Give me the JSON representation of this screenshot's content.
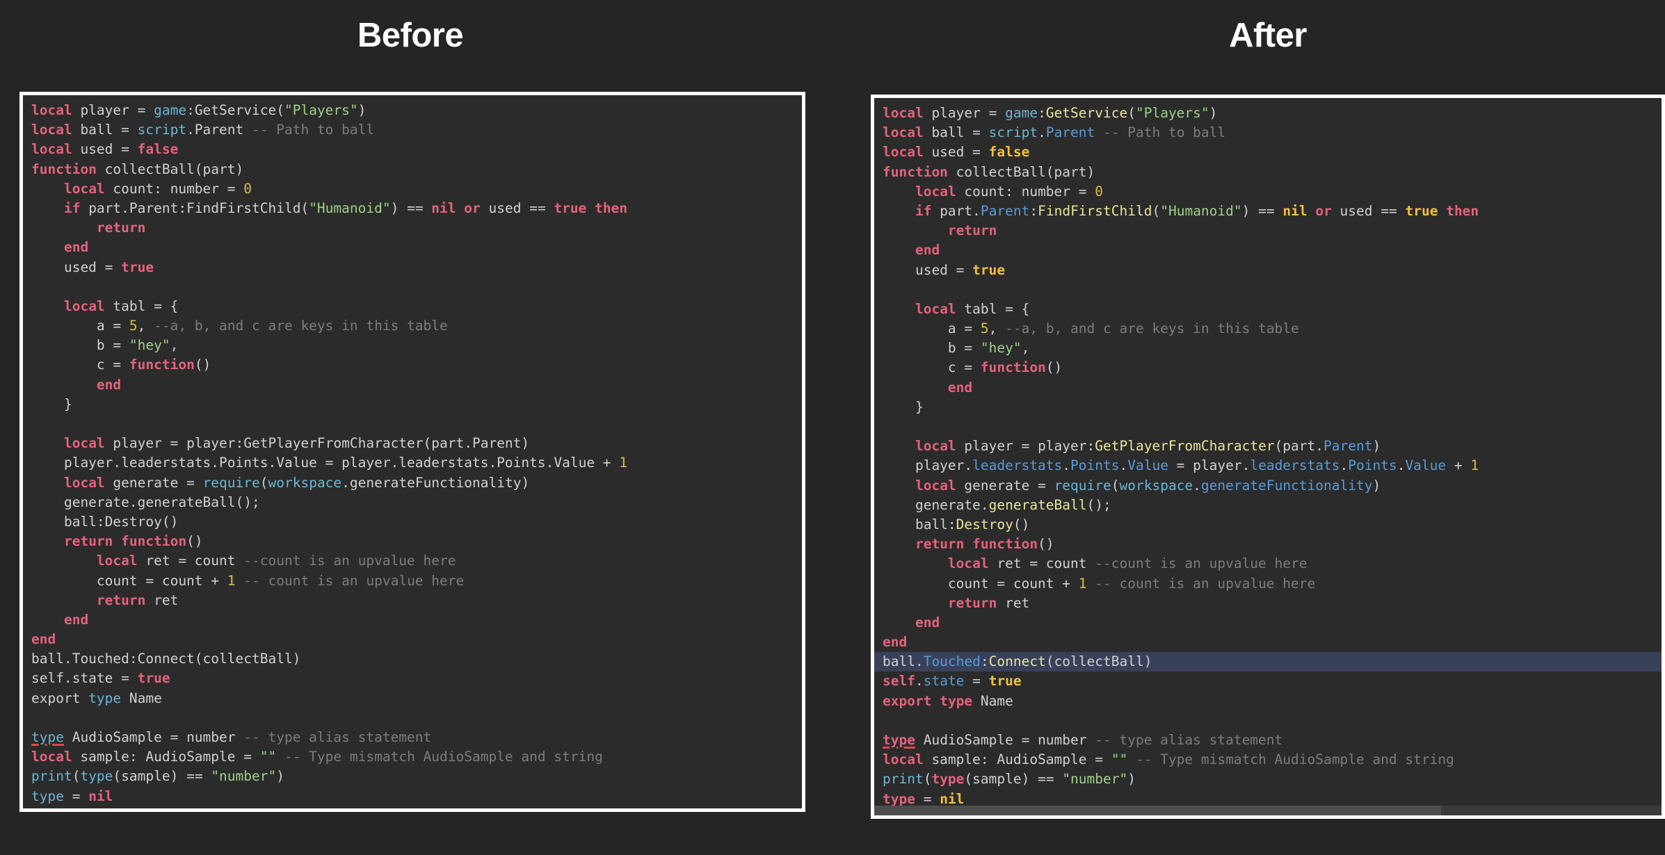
{
  "headings": {
    "before": "Before",
    "after": "After"
  },
  "theme": {
    "page_background": "#252525",
    "editor_background": "#2b2b2b",
    "panel_border": "#ffffff",
    "heading_color": "#ffffff",
    "selected_line_background": "#39415a",
    "error_underline": "#e0484c",
    "before": {
      "keyword": "#e4637c",
      "plain": "#cfd2d1",
      "string": "#9fd28a",
      "number": "#d9bf48",
      "comment": "#7d7d7d",
      "global": "#6cb5d6"
    },
    "after": {
      "keyword": "#e4637c",
      "plain": "#cfd2d1",
      "string": "#9fd28a",
      "number": "#d9bf48",
      "comment": "#7d7d7d",
      "boolean": "#f2c040",
      "property": "#5b9bd8",
      "method": "#e7e79b",
      "global": "#6cb5d6"
    }
  },
  "language": "Luau",
  "before_panel": {
    "selected_line_index": null,
    "has_horizontal_scrollbar": false,
    "lines": [
      [
        [
          "b-kw",
          "local"
        ],
        [
          "b-plain",
          " player = "
        ],
        [
          "b-blue",
          "game"
        ],
        [
          "b-plain",
          ":GetService("
        ],
        [
          "b-str",
          "\"Players\""
        ],
        [
          "b-plain",
          ")"
        ]
      ],
      [
        [
          "b-kw",
          "local"
        ],
        [
          "b-plain",
          " ball = "
        ],
        [
          "b-blue",
          "script"
        ],
        [
          "b-plain",
          ".Parent "
        ],
        [
          "b-cmt",
          "-- Path to ball"
        ]
      ],
      [
        [
          "b-kw",
          "local"
        ],
        [
          "b-plain",
          " used = "
        ],
        [
          "b-kw",
          "false"
        ]
      ],
      [
        [
          "b-kw",
          "function"
        ],
        [
          "b-plain",
          " collectBall(part)"
        ]
      ],
      [
        [
          "b-plain",
          "    "
        ],
        [
          "b-kw",
          "local"
        ],
        [
          "b-plain",
          " count: number = "
        ],
        [
          "b-num",
          "0"
        ]
      ],
      [
        [
          "b-plain",
          "    "
        ],
        [
          "b-kw",
          "if"
        ],
        [
          "b-plain",
          " part.Parent:FindFirstChild("
        ],
        [
          "b-str",
          "\"Humanoid\""
        ],
        [
          "b-plain",
          ") == "
        ],
        [
          "b-kw",
          "nil"
        ],
        [
          "b-plain",
          " "
        ],
        [
          "b-kw",
          "or"
        ],
        [
          "b-plain",
          " used == "
        ],
        [
          "b-kw",
          "true"
        ],
        [
          "b-plain",
          " "
        ],
        [
          "b-kw",
          "then"
        ]
      ],
      [
        [
          "b-plain",
          "        "
        ],
        [
          "b-kw",
          "return"
        ]
      ],
      [
        [
          "b-plain",
          "    "
        ],
        [
          "b-kw",
          "end"
        ]
      ],
      [
        [
          "b-plain",
          "    used = "
        ],
        [
          "b-kw",
          "true"
        ]
      ],
      [
        [
          "b-plain",
          ""
        ]
      ],
      [
        [
          "b-plain",
          "    "
        ],
        [
          "b-kw",
          "local"
        ],
        [
          "b-plain",
          " tabl = {"
        ]
      ],
      [
        [
          "b-plain",
          "        a = "
        ],
        [
          "b-num",
          "5"
        ],
        [
          "b-plain",
          ", "
        ],
        [
          "b-cmt",
          "--a, b, and c are keys in this table"
        ]
      ],
      [
        [
          "b-plain",
          "        b = "
        ],
        [
          "b-str",
          "\"hey\""
        ],
        [
          "b-plain",
          ","
        ]
      ],
      [
        [
          "b-plain",
          "        c = "
        ],
        [
          "b-kw",
          "function"
        ],
        [
          "b-plain",
          "()"
        ]
      ],
      [
        [
          "b-plain",
          "        "
        ],
        [
          "b-kw",
          "end"
        ]
      ],
      [
        [
          "b-plain",
          "    }"
        ]
      ],
      [
        [
          "b-plain",
          ""
        ]
      ],
      [
        [
          "b-plain",
          "    "
        ],
        [
          "b-kw",
          "local"
        ],
        [
          "b-plain",
          " player = player:GetPlayerFromCharacter(part.Parent)"
        ]
      ],
      [
        [
          "b-plain",
          "    player.leaderstats.Points.Value = player.leaderstats.Points.Value + "
        ],
        [
          "b-num",
          "1"
        ]
      ],
      [
        [
          "b-plain",
          "    "
        ],
        [
          "b-kw",
          "local"
        ],
        [
          "b-plain",
          " generate = "
        ],
        [
          "b-blue",
          "require"
        ],
        [
          "b-plain",
          "("
        ],
        [
          "b-blue",
          "workspace"
        ],
        [
          "b-plain",
          ".generateFunctionality)"
        ]
      ],
      [
        [
          "b-plain",
          "    generate.generateBall();"
        ]
      ],
      [
        [
          "b-plain",
          "    ball:Destroy()"
        ]
      ],
      [
        [
          "b-plain",
          "    "
        ],
        [
          "b-kw",
          "return function"
        ],
        [
          "b-plain",
          "()"
        ]
      ],
      [
        [
          "b-plain",
          "        "
        ],
        [
          "b-kw",
          "local"
        ],
        [
          "b-plain",
          " ret = count "
        ],
        [
          "b-cmt",
          "--count is an upvalue here"
        ]
      ],
      [
        [
          "b-plain",
          "        count = count + "
        ],
        [
          "b-num",
          "1"
        ],
        [
          "b-plain",
          " "
        ],
        [
          "b-cmt",
          "-- count is an upvalue here"
        ]
      ],
      [
        [
          "b-plain",
          "        "
        ],
        [
          "b-kw",
          "return"
        ],
        [
          "b-plain",
          " ret"
        ]
      ],
      [
        [
          "b-plain",
          "    "
        ],
        [
          "b-kw",
          "end"
        ]
      ],
      [
        [
          "b-kw",
          "end"
        ]
      ],
      [
        [
          "b-plain",
          "ball.Touched:Connect(collectBall)"
        ]
      ],
      [
        [
          "b-plain",
          "self.state = "
        ],
        [
          "b-kw",
          "true"
        ]
      ],
      [
        [
          "b-plain",
          "export "
        ],
        [
          "b-blue",
          "type"
        ],
        [
          "b-plain",
          " Name"
        ]
      ],
      [
        [
          "b-plain",
          ""
        ]
      ],
      [
        [
          "b-err",
          "type"
        ],
        [
          "b-plain",
          " AudioSample = number "
        ],
        [
          "b-cmt",
          "-- type alias statement"
        ]
      ],
      [
        [
          "b-kw",
          "local"
        ],
        [
          "b-plain",
          " sample: AudioSample = "
        ],
        [
          "b-str",
          "\"\""
        ],
        [
          "b-plain",
          " "
        ],
        [
          "b-cmt",
          "-- Type mismatch AudioSample and string"
        ]
      ],
      [
        [
          "b-blue",
          "print"
        ],
        [
          "b-plain",
          "("
        ],
        [
          "b-blue",
          "type"
        ],
        [
          "b-plain",
          "(sample) == "
        ],
        [
          "b-str",
          "\"number\""
        ],
        [
          "b-plain",
          ")"
        ]
      ],
      [
        [
          "b-blue",
          "type"
        ],
        [
          "b-plain",
          " = "
        ],
        [
          "b-kw",
          "nil"
        ]
      ]
    ]
  },
  "after_panel": {
    "selected_line_index": 28,
    "selected_line_text": "ball.Touched:Connect(collectBall)",
    "has_horizontal_scrollbar": true,
    "lines": [
      [
        [
          "a-kw",
          "local"
        ],
        [
          "a-plain",
          " player = "
        ],
        [
          "a-global",
          "game"
        ],
        [
          "a-plain",
          ":"
        ],
        [
          "a-method",
          "GetService"
        ],
        [
          "a-plain",
          "("
        ],
        [
          "a-str",
          "\"Players\""
        ],
        [
          "a-plain",
          ")"
        ]
      ],
      [
        [
          "a-kw",
          "local"
        ],
        [
          "a-plain",
          " ball = "
        ],
        [
          "a-global",
          "script"
        ],
        [
          "a-plain",
          "."
        ],
        [
          "a-prop",
          "Parent"
        ],
        [
          "a-plain",
          " "
        ],
        [
          "a-cmt",
          "-- Path to ball"
        ]
      ],
      [
        [
          "a-kw",
          "local"
        ],
        [
          "a-plain",
          " used = "
        ],
        [
          "a-bool",
          "false"
        ]
      ],
      [
        [
          "a-kw",
          "function"
        ],
        [
          "a-plain",
          " collectBall(part)"
        ]
      ],
      [
        [
          "a-plain",
          "    "
        ],
        [
          "a-kw",
          "local"
        ],
        [
          "a-plain",
          " count: number = "
        ],
        [
          "a-num",
          "0"
        ]
      ],
      [
        [
          "a-plain",
          "    "
        ],
        [
          "a-kw",
          "if"
        ],
        [
          "a-plain",
          " part."
        ],
        [
          "a-prop",
          "Parent"
        ],
        [
          "a-plain",
          ":"
        ],
        [
          "a-method",
          "FindFirstChild"
        ],
        [
          "a-plain",
          "("
        ],
        [
          "a-str",
          "\"Humanoid\""
        ],
        [
          "a-plain",
          ") == "
        ],
        [
          "a-bool",
          "nil"
        ],
        [
          "a-plain",
          " "
        ],
        [
          "a-kw",
          "or"
        ],
        [
          "a-plain",
          " used == "
        ],
        [
          "a-bool",
          "true"
        ],
        [
          "a-plain",
          " "
        ],
        [
          "a-kw",
          "then"
        ]
      ],
      [
        [
          "a-plain",
          "        "
        ],
        [
          "a-kw",
          "return"
        ]
      ],
      [
        [
          "a-plain",
          "    "
        ],
        [
          "a-kw",
          "end"
        ]
      ],
      [
        [
          "a-plain",
          "    used = "
        ],
        [
          "a-bool",
          "true"
        ]
      ],
      [
        [
          "a-plain",
          ""
        ]
      ],
      [
        [
          "a-plain",
          "    "
        ],
        [
          "a-kw",
          "local"
        ],
        [
          "a-plain",
          " tabl = {"
        ]
      ],
      [
        [
          "a-plain",
          "        a = "
        ],
        [
          "a-num",
          "5"
        ],
        [
          "a-plain",
          ", "
        ],
        [
          "a-cmt",
          "--a, b, and c are keys in this table"
        ]
      ],
      [
        [
          "a-plain",
          "        b = "
        ],
        [
          "a-str",
          "\"hey\""
        ],
        [
          "a-plain",
          ","
        ]
      ],
      [
        [
          "a-plain",
          "        c = "
        ],
        [
          "a-kw",
          "function"
        ],
        [
          "a-plain",
          "()"
        ]
      ],
      [
        [
          "a-plain",
          "        "
        ],
        [
          "a-kw",
          "end"
        ]
      ],
      [
        [
          "a-plain",
          "    }"
        ]
      ],
      [
        [
          "a-plain",
          ""
        ]
      ],
      [
        [
          "a-plain",
          "    "
        ],
        [
          "a-kw",
          "local"
        ],
        [
          "a-plain",
          " player = player:"
        ],
        [
          "a-method",
          "GetPlayerFromCharacter"
        ],
        [
          "a-plain",
          "(part."
        ],
        [
          "a-prop",
          "Parent"
        ],
        [
          "a-plain",
          ")"
        ]
      ],
      [
        [
          "a-plain",
          "    player."
        ],
        [
          "a-prop",
          "leaderstats"
        ],
        [
          "a-plain",
          "."
        ],
        [
          "a-prop",
          "Points"
        ],
        [
          "a-plain",
          "."
        ],
        [
          "a-prop",
          "Value"
        ],
        [
          "a-plain",
          " = player."
        ],
        [
          "a-prop",
          "leaderstats"
        ],
        [
          "a-plain",
          "."
        ],
        [
          "a-prop",
          "Points"
        ],
        [
          "a-plain",
          "."
        ],
        [
          "a-prop",
          "Value"
        ],
        [
          "a-plain",
          " + "
        ],
        [
          "a-num",
          "1"
        ]
      ],
      [
        [
          "a-plain",
          "    "
        ],
        [
          "a-kw",
          "local"
        ],
        [
          "a-plain",
          " generate = "
        ],
        [
          "a-global",
          "require"
        ],
        [
          "a-plain",
          "("
        ],
        [
          "a-global",
          "workspace"
        ],
        [
          "a-plain",
          "."
        ],
        [
          "a-prop",
          "generateFunctionality"
        ],
        [
          "a-plain",
          ")"
        ]
      ],
      [
        [
          "a-plain",
          "    generate."
        ],
        [
          "a-method",
          "generateBall"
        ],
        [
          "a-plain",
          "();"
        ]
      ],
      [
        [
          "a-plain",
          "    ball:"
        ],
        [
          "a-method",
          "Destroy"
        ],
        [
          "a-plain",
          "()"
        ]
      ],
      [
        [
          "a-plain",
          "    "
        ],
        [
          "a-kw",
          "return function"
        ],
        [
          "a-plain",
          "()"
        ]
      ],
      [
        [
          "a-plain",
          "        "
        ],
        [
          "a-kw",
          "local"
        ],
        [
          "a-plain",
          " ret = count "
        ],
        [
          "a-cmt",
          "--count is an upvalue here"
        ]
      ],
      [
        [
          "a-plain",
          "        count = count + "
        ],
        [
          "a-num",
          "1"
        ],
        [
          "a-plain",
          " "
        ],
        [
          "a-cmt",
          "-- count is an upvalue here"
        ]
      ],
      [
        [
          "a-plain",
          "        "
        ],
        [
          "a-kw",
          "return"
        ],
        [
          "a-plain",
          " ret"
        ]
      ],
      [
        [
          "a-plain",
          "    "
        ],
        [
          "a-kw",
          "end"
        ]
      ],
      [
        [
          "a-kw",
          "end"
        ]
      ],
      [
        [
          "a-plain",
          "ball."
        ],
        [
          "a-prop",
          "Touched"
        ],
        [
          "a-plain",
          ":"
        ],
        [
          "a-method",
          "Connect"
        ],
        [
          "a-plain",
          "(collectBall)"
        ]
      ],
      [
        [
          "a-self",
          "self"
        ],
        [
          "a-plain",
          "."
        ],
        [
          "a-prop",
          "state"
        ],
        [
          "a-plain",
          " = "
        ],
        [
          "a-bool",
          "true"
        ]
      ],
      [
        [
          "a-kw",
          "export"
        ],
        [
          "a-plain",
          " "
        ],
        [
          "a-kw",
          "type"
        ],
        [
          "a-plain",
          " Name"
        ]
      ],
      [
        [
          "a-plain",
          ""
        ]
      ],
      [
        [
          "a-err",
          "type"
        ],
        [
          "a-plain",
          " AudioSample = number "
        ],
        [
          "a-cmt",
          "-- type alias statement"
        ]
      ],
      [
        [
          "a-kw",
          "local"
        ],
        [
          "a-plain",
          " sample: AudioSample = "
        ],
        [
          "a-str",
          "\"\""
        ],
        [
          "a-plain",
          " "
        ],
        [
          "a-cmt",
          "-- Type mismatch AudioSample and string"
        ]
      ],
      [
        [
          "a-global",
          "print"
        ],
        [
          "a-plain",
          "("
        ],
        [
          "a-kw",
          "type"
        ],
        [
          "a-plain",
          "(sample) == "
        ],
        [
          "a-str",
          "\"number\""
        ],
        [
          "a-plain",
          ")"
        ]
      ],
      [
        [
          "a-kw",
          "type"
        ],
        [
          "a-plain",
          " = "
        ],
        [
          "a-bool",
          "nil"
        ]
      ]
    ]
  }
}
